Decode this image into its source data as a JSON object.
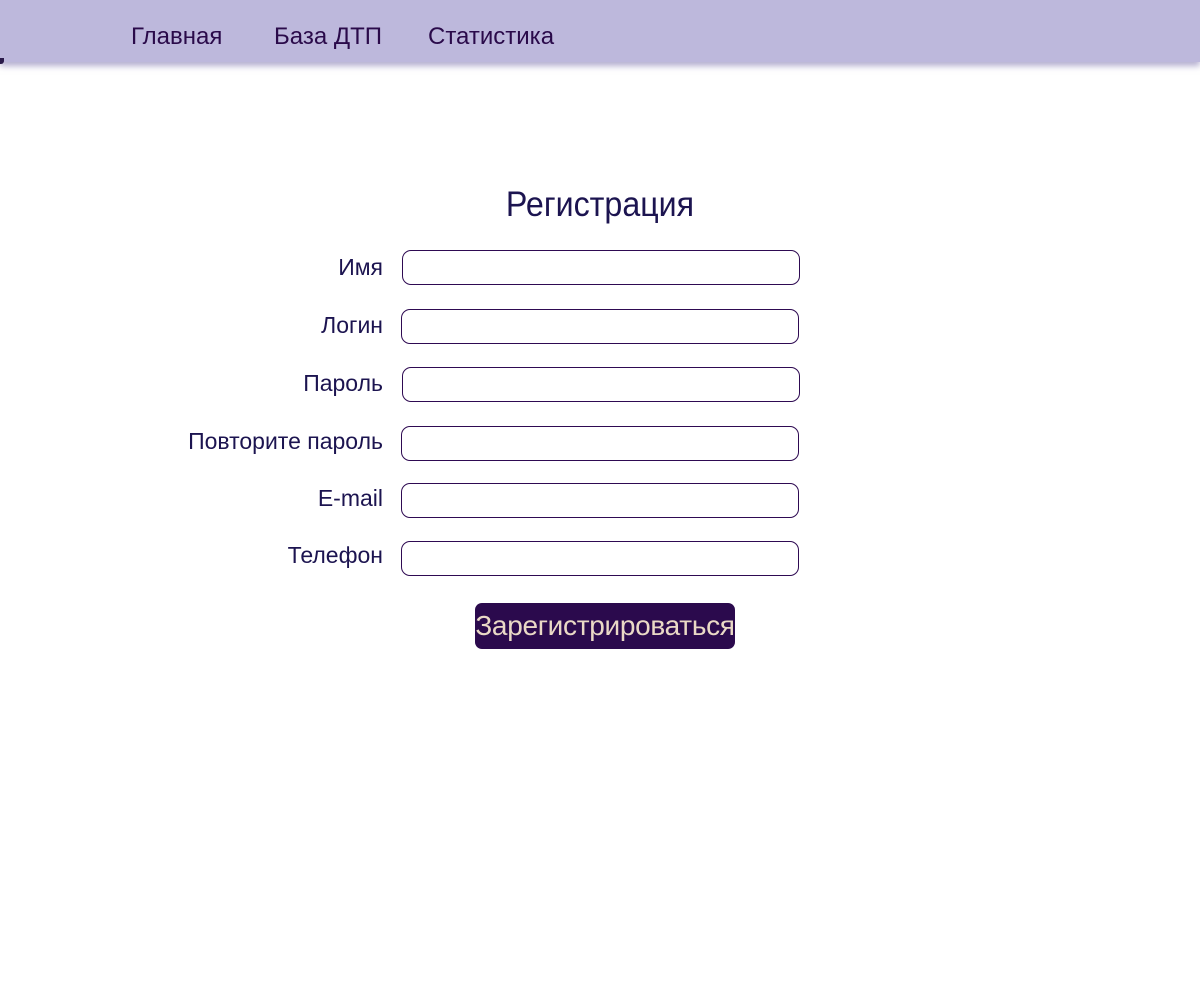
{
  "nav": {
    "items": [
      {
        "label": "Главная"
      },
      {
        "label": "База ДТП"
      },
      {
        "label": "Статистика"
      }
    ]
  },
  "form": {
    "title": "Регистрация",
    "fields": [
      {
        "label": "Имя",
        "value": ""
      },
      {
        "label": "Логин",
        "value": ""
      },
      {
        "label": "Пароль",
        "value": ""
      },
      {
        "label": "Повторите пароль",
        "value": ""
      },
      {
        "label": "E-mail",
        "value": ""
      },
      {
        "label": "Телефон",
        "value": ""
      }
    ],
    "submit_label": "Зарегистрироваться"
  },
  "colors": {
    "topbar": "#bdb8dc",
    "text": "#1c1450",
    "button_bg": "#2b0a4d",
    "button_text": "#ead9c6",
    "input_border": "#2e0a52"
  }
}
